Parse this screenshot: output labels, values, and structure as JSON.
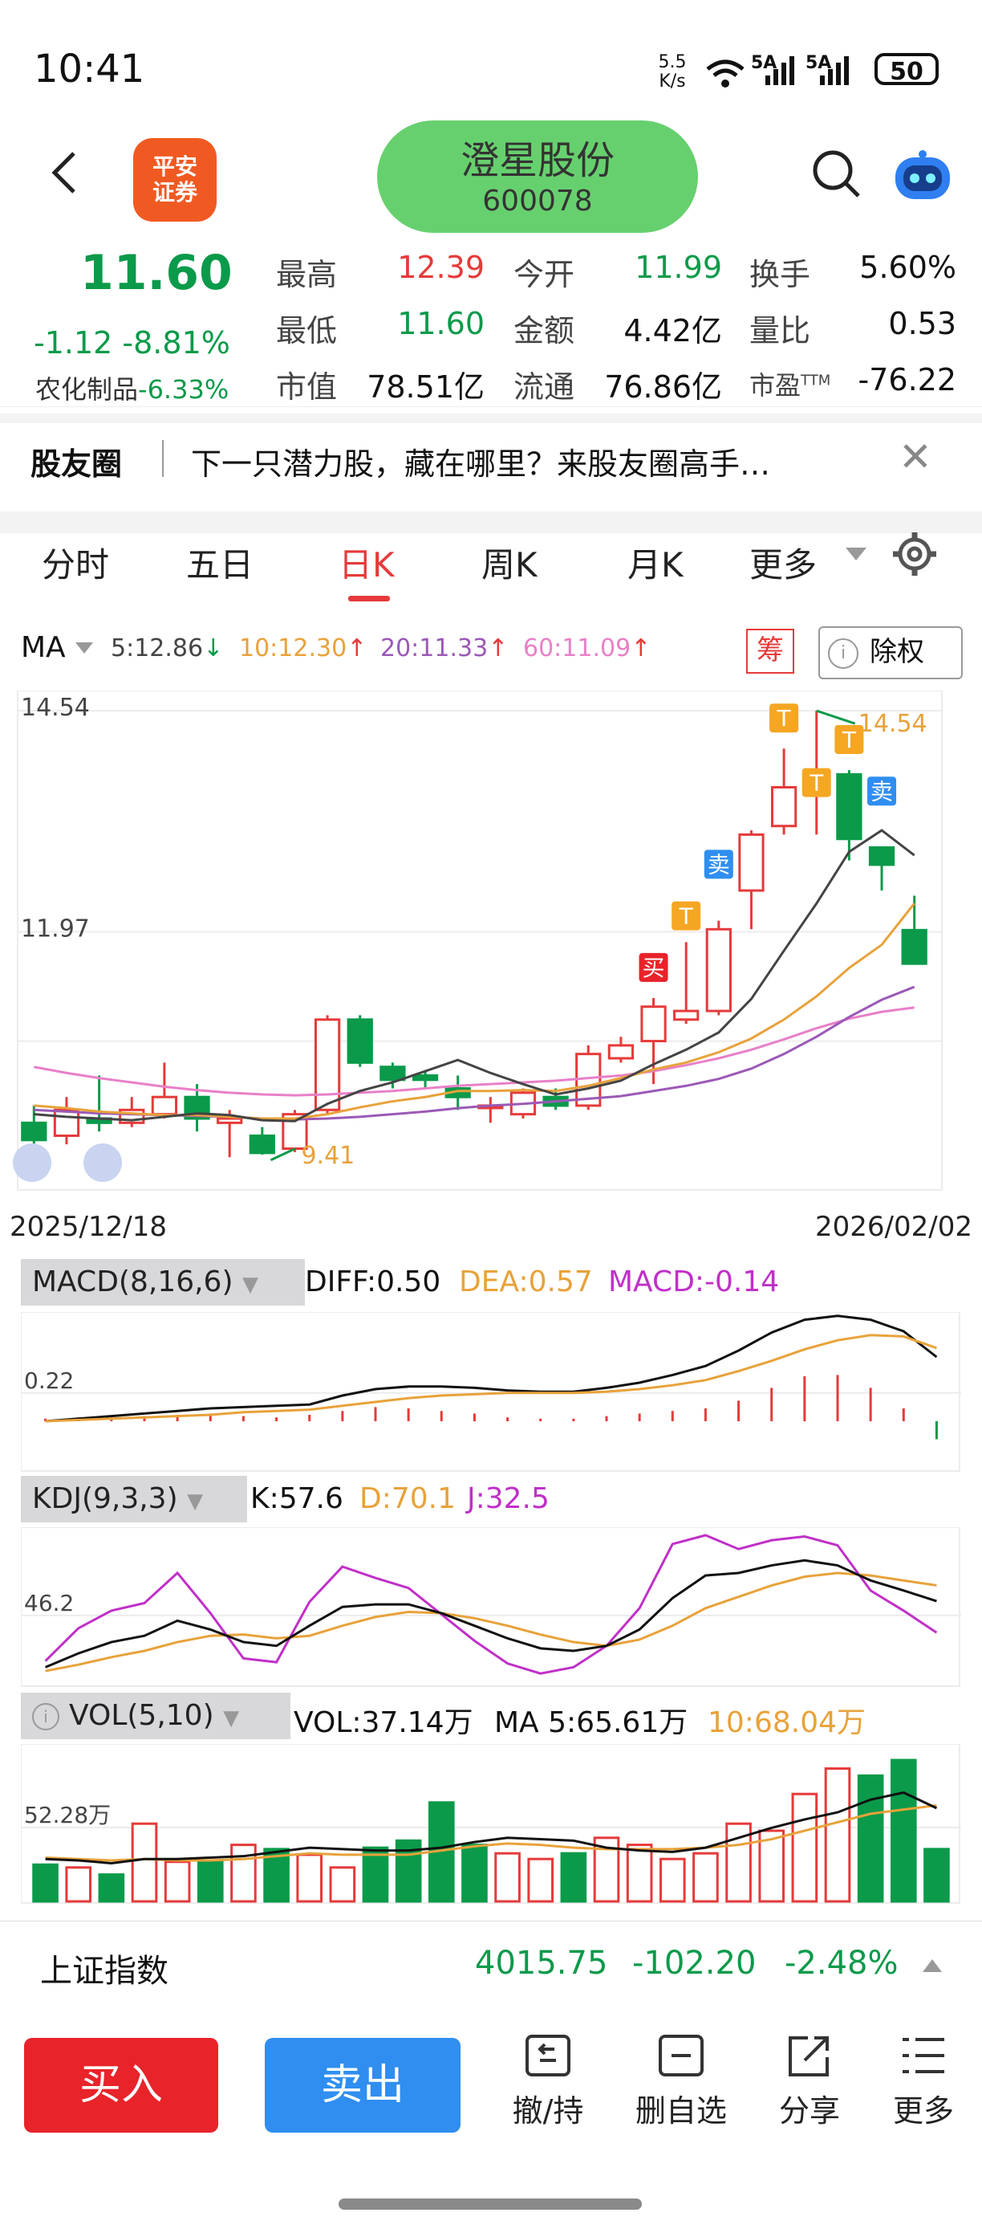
{
  "status": {
    "time": "10:41",
    "net_speed": "5.5 K/s",
    "signal1": "5A",
    "signal2": "5A",
    "battery": "50"
  },
  "header": {
    "logo_line1": "平安",
    "logo_line2": "证券",
    "stock_name": "澄星股份",
    "stock_code": "600078"
  },
  "quote": {
    "price": "11.60",
    "change": "-1.12",
    "change_pct": "-8.81%",
    "sector_label": "农化制品",
    "sector_pct": "-6.33%",
    "high_label": "最高",
    "high": "12.39",
    "open_label": "今开",
    "open": "11.99",
    "turnover_label": "换手",
    "turnover": "5.60%",
    "low_label": "最低",
    "low": "11.60",
    "amount_label": "金额",
    "amount": "4.42亿",
    "vratio_label": "量比",
    "vratio": "0.53",
    "mcap_label": "市值",
    "mcap": "78.51亿",
    "float_label": "流通",
    "float": "76.86亿",
    "pe_label": "市盈",
    "pe_sup": "TTM",
    "pe": "-76.22"
  },
  "banner": {
    "title": "股友圈",
    "text": "下一只潜力股，藏在哪里？来股友圈高手…"
  },
  "tabs": [
    "分时",
    "五日",
    "日K",
    "周K",
    "月K",
    "更多"
  ],
  "active_tab": "日K",
  "ma": {
    "label": "MA",
    "ma5": "5:12.86",
    "ma10": "10:12.30",
    "ma20": "20:11.33",
    "ma60": "60:11.09"
  },
  "chips": {
    "chou": "筹",
    "fuquan": "除权"
  },
  "colors": {
    "up": "#e63a3a",
    "down": "#0a9a4a",
    "ma5": "#444444",
    "ma10": "#e8a23a",
    "ma20": "#9b59b6",
    "ma60": "#e880c8",
    "buy": "#e8232a",
    "sell": "#2f8ef0"
  },
  "chart_data": [
    {
      "type": "candlestick",
      "title": "日K",
      "x_start": "2025/12/18",
      "x_end": "2026/02/02",
      "ylabel_top": "14.54",
      "ylabel_mid": "11.97",
      "max_label": "14.54",
      "min_label": "9.41",
      "ylim": [
        9.1,
        14.7
      ],
      "candles": [
        {
          "o": 9.75,
          "c": 9.55,
          "h": 9.95,
          "l": 9.45
        },
        {
          "o": 9.6,
          "c": 9.9,
          "h": 10.05,
          "l": 9.5
        },
        {
          "o": 9.8,
          "c": 9.75,
          "h": 10.3,
          "l": 9.65
        },
        {
          "o": 9.75,
          "c": 9.9,
          "h": 10.05,
          "l": 9.7
        },
        {
          "o": 9.85,
          "c": 10.05,
          "h": 10.45,
          "l": 9.8
        },
        {
          "o": 10.05,
          "c": 9.8,
          "h": 10.2,
          "l": 9.65
        },
        {
          "o": 9.75,
          "c": 9.8,
          "h": 9.9,
          "l": 9.35
        },
        {
          "o": 9.6,
          "c": 9.4,
          "h": 9.7,
          "l": 9.38
        },
        {
          "o": 9.45,
          "c": 9.85,
          "h": 9.9,
          "l": 9.41
        },
        {
          "o": 9.9,
          "c": 10.95,
          "h": 11.0,
          "l": 9.85
        },
        {
          "o": 10.95,
          "c": 10.45,
          "h": 11.0,
          "l": 10.4
        },
        {
          "o": 10.4,
          "c": 10.25,
          "h": 10.45,
          "l": 10.15
        },
        {
          "o": 10.3,
          "c": 10.25,
          "h": 10.35,
          "l": 10.15
        },
        {
          "o": 10.15,
          "c": 10.05,
          "h": 10.3,
          "l": 9.9
        },
        {
          "o": 9.95,
          "c": 9.95,
          "h": 10.05,
          "l": 9.75
        },
        {
          "o": 9.85,
          "c": 10.1,
          "h": 10.15,
          "l": 9.8
        },
        {
          "o": 10.05,
          "c": 9.95,
          "h": 10.15,
          "l": 9.9
        },
        {
          "o": 9.95,
          "c": 10.55,
          "h": 10.65,
          "l": 9.9
        },
        {
          "o": 10.5,
          "c": 10.65,
          "h": 10.75,
          "l": 10.45
        },
        {
          "o": 10.7,
          "c": 11.1,
          "h": 11.2,
          "l": 10.2
        },
        {
          "o": 10.95,
          "c": 11.05,
          "h": 11.85,
          "l": 10.9
        },
        {
          "o": 11.05,
          "c": 12.0,
          "h": 12.1,
          "l": 11.0
        },
        {
          "o": 12.45,
          "c": 13.1,
          "h": 13.15,
          "l": 12.0
        },
        {
          "o": 13.2,
          "c": 13.65,
          "h": 14.1,
          "l": 13.1
        },
        {
          "o": 13.7,
          "c": 13.85,
          "h": 14.54,
          "l": 13.1
        },
        {
          "o": 13.8,
          "c": 13.05,
          "h": 13.85,
          "l": 12.8
        },
        {
          "o": 12.95,
          "c": 12.75,
          "h": 12.95,
          "l": 12.45
        },
        {
          "o": 11.99,
          "c": 11.6,
          "h": 12.39,
          "l": 11.6
        }
      ],
      "ma5": [
        9.85,
        9.82,
        9.8,
        9.78,
        9.82,
        9.86,
        9.84,
        9.78,
        9.77,
        9.97,
        10.12,
        10.22,
        10.35,
        10.48,
        10.33,
        10.2,
        10.08,
        10.15,
        10.24,
        10.43,
        10.6,
        10.8,
        11.19,
        11.75,
        12.3,
        12.9,
        13.15,
        12.86
      ],
      "ma10": [
        9.95,
        9.92,
        9.88,
        9.86,
        9.84,
        9.84,
        9.82,
        9.8,
        9.8,
        9.85,
        9.93,
        10.0,
        10.05,
        10.12,
        10.12,
        10.13,
        10.12,
        10.18,
        10.27,
        10.37,
        10.45,
        10.57,
        10.73,
        10.95,
        11.22,
        11.55,
        11.82,
        12.3
      ],
      "ma20": [
        9.9,
        9.88,
        9.86,
        9.85,
        9.84,
        9.83,
        9.82,
        9.8,
        9.79,
        9.8,
        9.82,
        9.85,
        9.88,
        9.92,
        9.95,
        9.97,
        10.0,
        10.03,
        10.06,
        10.12,
        10.18,
        10.26,
        10.38,
        10.55,
        10.75,
        10.98,
        11.18,
        11.33
      ],
      "ma60": [
        10.4,
        10.33,
        10.27,
        10.22,
        10.17,
        10.13,
        10.1,
        10.08,
        10.07,
        10.08,
        10.1,
        10.12,
        10.15,
        10.18,
        10.2,
        10.22,
        10.24,
        10.27,
        10.3,
        10.35,
        10.42,
        10.5,
        10.6,
        10.72,
        10.85,
        10.96,
        11.04,
        11.09
      ]
    },
    {
      "type": "bar",
      "title": "MACD(8,16,6)",
      "diff": "DIFF:0.50",
      "dea": "DEA:0.57",
      "macd": "MACD:-0.14",
      "ylabel": "0.22",
      "ylim": [
        -0.35,
        0.8
      ],
      "macd_bars": [
        0.02,
        0.03,
        0.03,
        0.04,
        0.05,
        0.06,
        0.04,
        0.03,
        0.05,
        0.08,
        0.11,
        0.1,
        0.08,
        0.06,
        0.03,
        0.02,
        0.02,
        0.04,
        0.06,
        0.08,
        0.1,
        0.16,
        0.26,
        0.35,
        0.36,
        0.26,
        0.1,
        -0.14
      ],
      "diff_line": [
        0.0,
        0.02,
        0.04,
        0.06,
        0.08,
        0.1,
        0.11,
        0.12,
        0.13,
        0.2,
        0.25,
        0.27,
        0.27,
        0.26,
        0.24,
        0.23,
        0.23,
        0.26,
        0.3,
        0.36,
        0.43,
        0.55,
        0.69,
        0.79,
        0.82,
        0.79,
        0.7,
        0.5
      ],
      "dea_line": [
        0.0,
        0.01,
        0.02,
        0.03,
        0.04,
        0.05,
        0.07,
        0.08,
        0.09,
        0.12,
        0.15,
        0.18,
        0.2,
        0.21,
        0.22,
        0.22,
        0.22,
        0.23,
        0.25,
        0.28,
        0.32,
        0.39,
        0.47,
        0.56,
        0.63,
        0.67,
        0.66,
        0.57
      ]
    },
    {
      "type": "line",
      "title": "KDJ(9,3,3)",
      "k": "K:57.6",
      "d": "D:70.1",
      "j": "J:32.5",
      "ylabel": "46.2",
      "ylim": [
        0,
        100
      ],
      "k_line": [
        5,
        16,
        25,
        30,
        42,
        35,
        25,
        22,
        38,
        53,
        55,
        55,
        48,
        38,
        28,
        20,
        18,
        22,
        35,
        60,
        78,
        80,
        86,
        90,
        86,
        74,
        66,
        57.6
      ],
      "d_line": [
        2,
        7,
        13,
        18,
        25,
        30,
        31,
        28,
        30,
        38,
        45,
        49,
        48,
        44,
        38,
        31,
        25,
        22,
        27,
        38,
        52,
        61,
        70,
        77,
        80,
        78,
        74,
        70.1
      ],
      "j_line": [
        10,
        36,
        50,
        56,
        80,
        48,
        12,
        9,
        57,
        85,
        76,
        68,
        47,
        26,
        8,
        0,
        5,
        22,
        52,
        103,
        110,
        99,
        106,
        109,
        102,
        66,
        50,
        32.5
      ]
    },
    {
      "type": "bar",
      "title": "VOL(5,10)",
      "vol": "VOL:37.14万",
      "ma5": "MA 5:65.61万",
      "ma10": "10:68.04万",
      "ylabel": "52.28万",
      "ylim": [
        0,
        100
      ],
      "volumes": [
        26,
        24,
        19,
        55,
        28,
        28,
        40,
        37,
        33,
        24,
        38,
        43,
        70,
        40,
        34,
        30,
        34,
        45,
        40,
        30,
        34,
        55,
        50,
        76,
        94,
        89,
        100,
        37
      ],
      "vol_ma5": [
        30,
        29,
        27,
        30,
        30,
        31,
        32,
        35,
        38,
        37,
        36,
        36,
        38,
        42,
        45,
        44,
        43,
        38,
        36,
        35,
        38,
        45,
        52,
        58,
        63,
        72,
        77,
        66
      ],
      "vol_ma10": [
        31,
        30,
        29,
        30,
        29,
        29,
        30,
        32,
        34,
        33,
        33,
        33,
        36,
        39,
        41,
        40,
        38,
        37,
        37,
        37,
        38,
        40,
        44,
        50,
        56,
        62,
        65,
        68
      ]
    }
  ],
  "index_bar": {
    "name": "上证指数",
    "value": "4015.75",
    "change": "-102.20",
    "pct": "-2.48%"
  },
  "actions": {
    "buy": "买入",
    "sell": "卖出",
    "revoke": "撤/持",
    "del_fav": "删自选",
    "share": "分享",
    "more": "更多"
  }
}
